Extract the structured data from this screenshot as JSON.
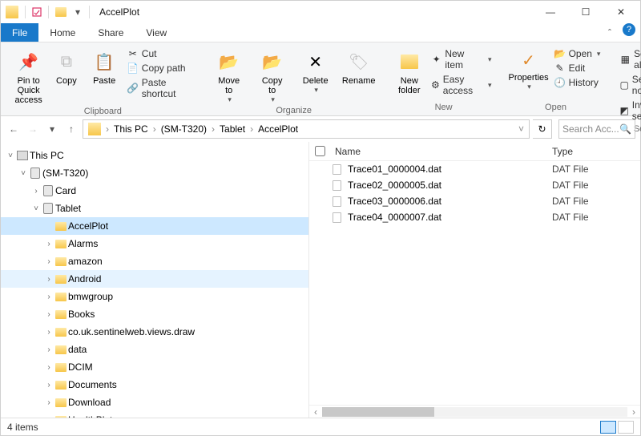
{
  "window": {
    "title": "AccelPlot",
    "min": "—",
    "max": "☐",
    "close": "✕"
  },
  "tabs": {
    "file": "File",
    "home": "Home",
    "share": "Share",
    "view": "View"
  },
  "ribbon": {
    "clipboard": {
      "pin": "Pin to Quick\naccess",
      "copy": "Copy",
      "paste": "Paste",
      "cut": "Cut",
      "copypath": "Copy path",
      "pasteshortcut": "Paste shortcut",
      "label": "Clipboard"
    },
    "organize": {
      "moveto": "Move\nto",
      "copyto": "Copy\nto",
      "delete": "Delete",
      "rename": "Rename",
      "label": "Organize"
    },
    "new": {
      "newfolder": "New\nfolder",
      "newitem": "New item",
      "easyaccess": "Easy access",
      "label": "New"
    },
    "open": {
      "properties": "Properties",
      "open": "Open",
      "edit": "Edit",
      "history": "History",
      "label": "Open"
    },
    "select": {
      "selectall": "Select all",
      "selectnone": "Select none",
      "invert": "Invert selection",
      "label": "Select"
    }
  },
  "breadcrumb": [
    "This PC",
    "(SM-T320)",
    "Tablet",
    "AccelPlot"
  ],
  "search": {
    "placeholder": "Search Acc..."
  },
  "tree": [
    {
      "d": 0,
      "tw": "v",
      "ic": "pc",
      "label": "This PC"
    },
    {
      "d": 1,
      "tw": "v",
      "ic": "dev",
      "label": "(SM-T320)"
    },
    {
      "d": 2,
      "tw": ">",
      "ic": "dev",
      "label": "Card"
    },
    {
      "d": 2,
      "tw": "v",
      "ic": "dev",
      "label": "Tablet"
    },
    {
      "d": 3,
      "tw": "",
      "ic": "fld",
      "label": "AccelPlot",
      "sel": true
    },
    {
      "d": 3,
      "tw": ">",
      "ic": "fld",
      "label": "Alarms"
    },
    {
      "d": 3,
      "tw": ">",
      "ic": "fld",
      "label": "amazon"
    },
    {
      "d": 3,
      "tw": ">",
      "ic": "fld",
      "label": "Android",
      "hi": true
    },
    {
      "d": 3,
      "tw": ">",
      "ic": "fld",
      "label": "bmwgroup"
    },
    {
      "d": 3,
      "tw": ">",
      "ic": "fld",
      "label": "Books"
    },
    {
      "d": 3,
      "tw": ">",
      "ic": "fld",
      "label": "co.uk.sentinelweb.views.draw"
    },
    {
      "d": 3,
      "tw": ">",
      "ic": "fld",
      "label": "data"
    },
    {
      "d": 3,
      "tw": ">",
      "ic": "fld",
      "label": "DCIM"
    },
    {
      "d": 3,
      "tw": ">",
      "ic": "fld",
      "label": "Documents"
    },
    {
      "d": 3,
      "tw": ">",
      "ic": "fld",
      "label": "Download"
    },
    {
      "d": 3,
      "tw": ">",
      "ic": "fld",
      "label": "HealthPlot"
    }
  ],
  "columns": {
    "name": "Name",
    "type": "Type"
  },
  "files": [
    {
      "name": "Trace01_0000004.dat",
      "type": "DAT File"
    },
    {
      "name": "Trace02_0000005.dat",
      "type": "DAT File"
    },
    {
      "name": "Trace03_0000006.dat",
      "type": "DAT File"
    },
    {
      "name": "Trace04_0000007.dat",
      "type": "DAT File"
    }
  ],
  "status": {
    "items": "4 items"
  }
}
